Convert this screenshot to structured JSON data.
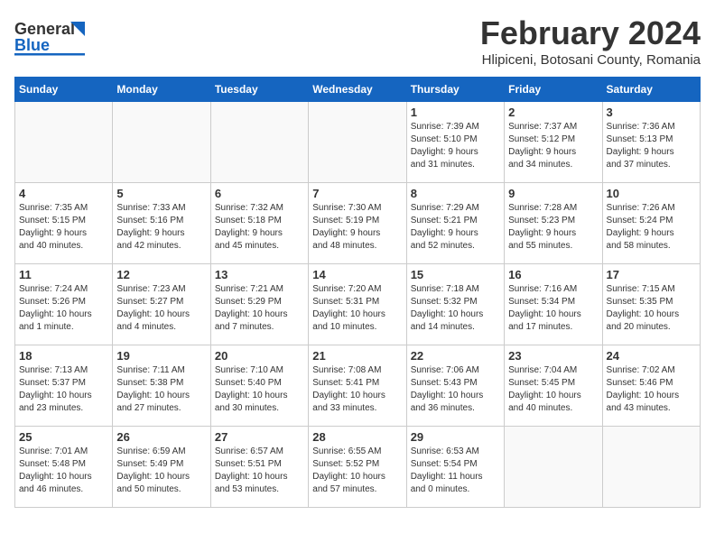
{
  "header": {
    "logo_general": "General",
    "logo_blue": "Blue",
    "title": "February 2024",
    "location": "Hlipiceni, Botosani County, Romania"
  },
  "columns": [
    "Sunday",
    "Monday",
    "Tuesday",
    "Wednesday",
    "Thursday",
    "Friday",
    "Saturday"
  ],
  "weeks": [
    [
      {
        "day": "",
        "info": ""
      },
      {
        "day": "",
        "info": ""
      },
      {
        "day": "",
        "info": ""
      },
      {
        "day": "",
        "info": ""
      },
      {
        "day": "1",
        "info": "Sunrise: 7:39 AM\nSunset: 5:10 PM\nDaylight: 9 hours\nand 31 minutes."
      },
      {
        "day": "2",
        "info": "Sunrise: 7:37 AM\nSunset: 5:12 PM\nDaylight: 9 hours\nand 34 minutes."
      },
      {
        "day": "3",
        "info": "Sunrise: 7:36 AM\nSunset: 5:13 PM\nDaylight: 9 hours\nand 37 minutes."
      }
    ],
    [
      {
        "day": "4",
        "info": "Sunrise: 7:35 AM\nSunset: 5:15 PM\nDaylight: 9 hours\nand 40 minutes."
      },
      {
        "day": "5",
        "info": "Sunrise: 7:33 AM\nSunset: 5:16 PM\nDaylight: 9 hours\nand 42 minutes."
      },
      {
        "day": "6",
        "info": "Sunrise: 7:32 AM\nSunset: 5:18 PM\nDaylight: 9 hours\nand 45 minutes."
      },
      {
        "day": "7",
        "info": "Sunrise: 7:30 AM\nSunset: 5:19 PM\nDaylight: 9 hours\nand 48 minutes."
      },
      {
        "day": "8",
        "info": "Sunrise: 7:29 AM\nSunset: 5:21 PM\nDaylight: 9 hours\nand 52 minutes."
      },
      {
        "day": "9",
        "info": "Sunrise: 7:28 AM\nSunset: 5:23 PM\nDaylight: 9 hours\nand 55 minutes."
      },
      {
        "day": "10",
        "info": "Sunrise: 7:26 AM\nSunset: 5:24 PM\nDaylight: 9 hours\nand 58 minutes."
      }
    ],
    [
      {
        "day": "11",
        "info": "Sunrise: 7:24 AM\nSunset: 5:26 PM\nDaylight: 10 hours\nand 1 minute."
      },
      {
        "day": "12",
        "info": "Sunrise: 7:23 AM\nSunset: 5:27 PM\nDaylight: 10 hours\nand 4 minutes."
      },
      {
        "day": "13",
        "info": "Sunrise: 7:21 AM\nSunset: 5:29 PM\nDaylight: 10 hours\nand 7 minutes."
      },
      {
        "day": "14",
        "info": "Sunrise: 7:20 AM\nSunset: 5:31 PM\nDaylight: 10 hours\nand 10 minutes."
      },
      {
        "day": "15",
        "info": "Sunrise: 7:18 AM\nSunset: 5:32 PM\nDaylight: 10 hours\nand 14 minutes."
      },
      {
        "day": "16",
        "info": "Sunrise: 7:16 AM\nSunset: 5:34 PM\nDaylight: 10 hours\nand 17 minutes."
      },
      {
        "day": "17",
        "info": "Sunrise: 7:15 AM\nSunset: 5:35 PM\nDaylight: 10 hours\nand 20 minutes."
      }
    ],
    [
      {
        "day": "18",
        "info": "Sunrise: 7:13 AM\nSunset: 5:37 PM\nDaylight: 10 hours\nand 23 minutes."
      },
      {
        "day": "19",
        "info": "Sunrise: 7:11 AM\nSunset: 5:38 PM\nDaylight: 10 hours\nand 27 minutes."
      },
      {
        "day": "20",
        "info": "Sunrise: 7:10 AM\nSunset: 5:40 PM\nDaylight: 10 hours\nand 30 minutes."
      },
      {
        "day": "21",
        "info": "Sunrise: 7:08 AM\nSunset: 5:41 PM\nDaylight: 10 hours\nand 33 minutes."
      },
      {
        "day": "22",
        "info": "Sunrise: 7:06 AM\nSunset: 5:43 PM\nDaylight: 10 hours\nand 36 minutes."
      },
      {
        "day": "23",
        "info": "Sunrise: 7:04 AM\nSunset: 5:45 PM\nDaylight: 10 hours\nand 40 minutes."
      },
      {
        "day": "24",
        "info": "Sunrise: 7:02 AM\nSunset: 5:46 PM\nDaylight: 10 hours\nand 43 minutes."
      }
    ],
    [
      {
        "day": "25",
        "info": "Sunrise: 7:01 AM\nSunset: 5:48 PM\nDaylight: 10 hours\nand 46 minutes."
      },
      {
        "day": "26",
        "info": "Sunrise: 6:59 AM\nSunset: 5:49 PM\nDaylight: 10 hours\nand 50 minutes."
      },
      {
        "day": "27",
        "info": "Sunrise: 6:57 AM\nSunset: 5:51 PM\nDaylight: 10 hours\nand 53 minutes."
      },
      {
        "day": "28",
        "info": "Sunrise: 6:55 AM\nSunset: 5:52 PM\nDaylight: 10 hours\nand 57 minutes."
      },
      {
        "day": "29",
        "info": "Sunrise: 6:53 AM\nSunset: 5:54 PM\nDaylight: 11 hours\nand 0 minutes."
      },
      {
        "day": "",
        "info": ""
      },
      {
        "day": "",
        "info": ""
      }
    ]
  ]
}
